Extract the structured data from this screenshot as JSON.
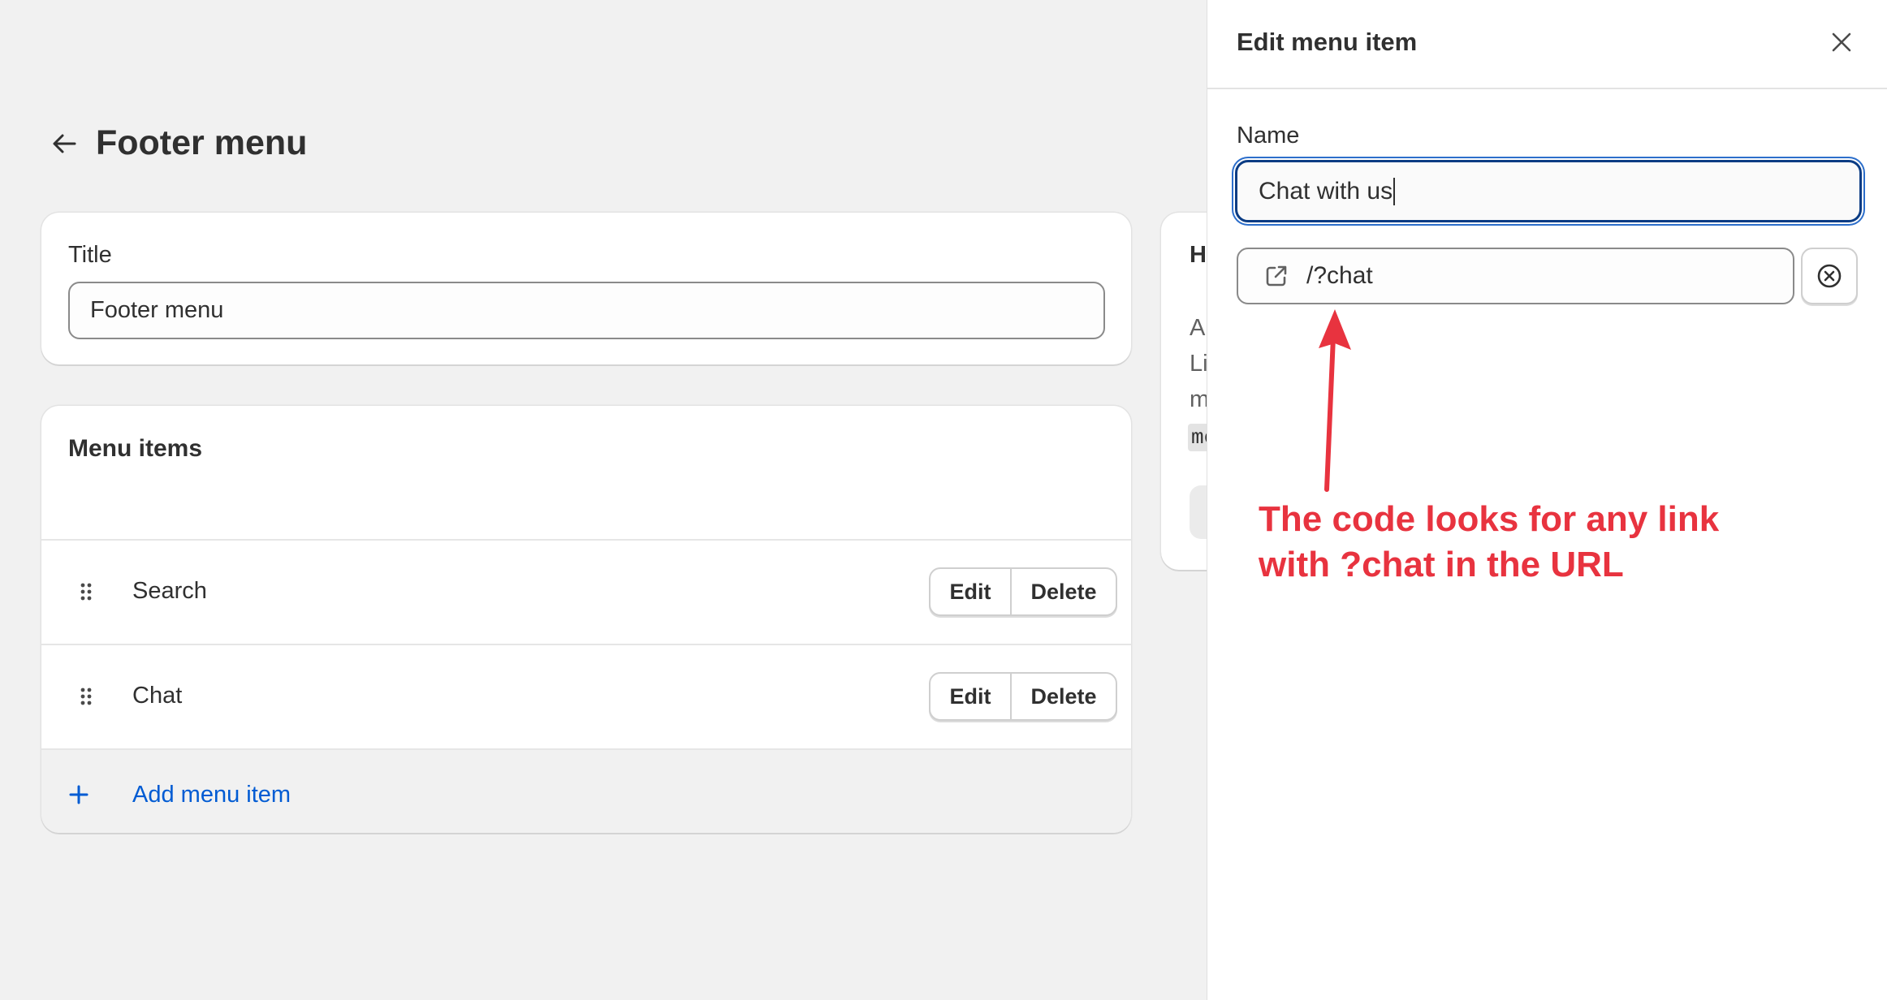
{
  "page": {
    "title": "Footer menu"
  },
  "title_card": {
    "label": "Title",
    "value": "Footer menu"
  },
  "menu_card": {
    "heading": "Menu items",
    "items": [
      {
        "label": "Search",
        "edit_label": "Edit",
        "delete_label": "Delete"
      },
      {
        "label": "Chat",
        "edit_label": "Edit",
        "delete_label": "Delete"
      }
    ],
    "add_label": "Add menu item"
  },
  "help_card": {
    "visible_fragments": [
      "H",
      "A",
      "Li",
      "m",
      "me"
    ]
  },
  "panel": {
    "title": "Edit menu item",
    "name_label": "Name",
    "name_value": "Chat with us",
    "link_value": "/?chat"
  },
  "annotation": {
    "line1": "The code looks for any link",
    "line2": "with ?chat in the URL",
    "color": "#e8333f"
  },
  "colors": {
    "link": "#005bd3",
    "focus_border": "#0b3c84",
    "background": "#f1f1f1"
  },
  "icons": [
    "back-arrow-icon",
    "drag-handle-icon",
    "plus-icon",
    "close-icon",
    "external-link-icon",
    "clear-circle-icon"
  ]
}
